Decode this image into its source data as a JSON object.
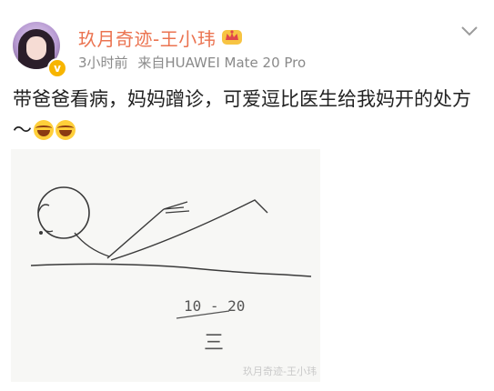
{
  "header": {
    "username": "玖月奇迹-王小玮",
    "time": "3小时前",
    "source": "来自HUAWEI Mate 20 Pro"
  },
  "post": {
    "text": "带爸爸看病，妈妈蹭诊，可爱逗比医生给我妈开的处方～"
  },
  "image": {
    "note_top": "10 - 20",
    "note_bottom": "三",
    "watermark": "玖月奇迹-王小玮"
  },
  "colors": {
    "username": "#eb7350",
    "meta": "#8a8a8a",
    "verified": "#f7b500"
  },
  "icons": [
    "verified-icon",
    "vip-crown-icon",
    "chevron-down-icon",
    "laughing-tears-emoji-icon"
  ]
}
